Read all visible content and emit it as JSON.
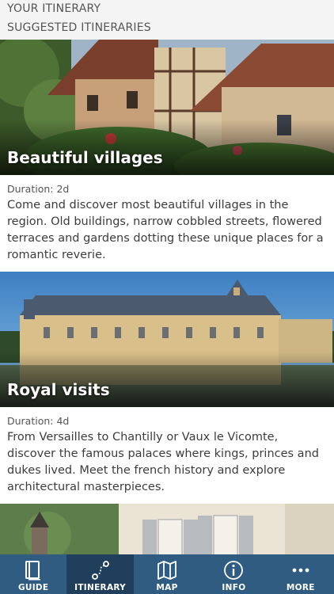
{
  "header": {
    "line1": "YOUR ITINERARY",
    "line2": "SUGGESTED ITINERARIES"
  },
  "itineraries": [
    {
      "title": "Beautiful villages",
      "duration": "Duration: 2d",
      "description": "Come and discover most beautiful villages in the region. Old buildings, narrow cobbled streets, flowered terraces and gardens dotting these unique places for a romantic reverie."
    },
    {
      "title": "Royal visits",
      "duration": "Duration: 4d",
      "description": "From Versailles to Chantilly or Vaux le Vicomte, discover the famous palaces where kings, princes and dukes lived. Meet the french history and explore architectural masterpieces."
    }
  ],
  "tabs": [
    {
      "label": "GUIDE",
      "icon": "book-icon",
      "active": false
    },
    {
      "label": "ITINERARY",
      "icon": "route-icon",
      "active": true
    },
    {
      "label": "MAP",
      "icon": "map-icon",
      "active": false
    },
    {
      "label": "INFO",
      "icon": "info-icon",
      "active": false
    },
    {
      "label": "MORE",
      "icon": "more-icon",
      "active": false
    }
  ],
  "colors": {
    "tabbar": "#2f5c80",
    "tab_active": "#1f3f5c",
    "header_bg": "#f4f4f4"
  }
}
